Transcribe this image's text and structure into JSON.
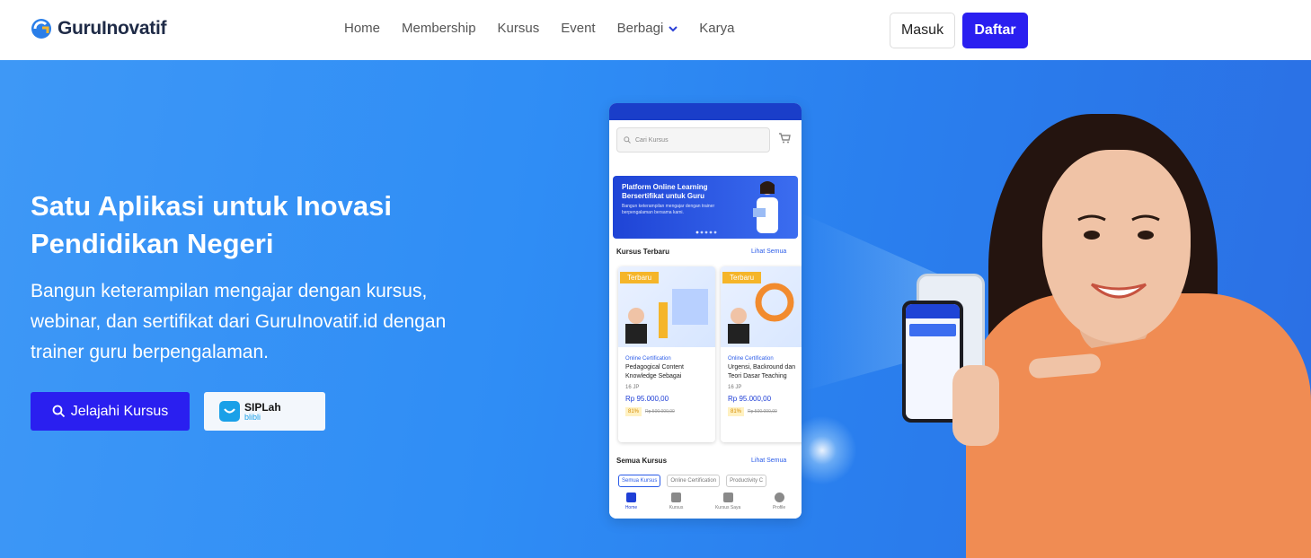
{
  "nav": {
    "logo_text": "GuruInovatif",
    "menu": [
      {
        "label": "Home"
      },
      {
        "label": "Membership"
      },
      {
        "label": "Kursus"
      },
      {
        "label": "Event"
      },
      {
        "label": "Berbagi",
        "has_dropdown": true
      },
      {
        "label": "Karya"
      }
    ],
    "login_label": "Masuk",
    "register_label": "Daftar"
  },
  "hero": {
    "title": "Satu Aplikasi untuk Inovasi Pendidikan Negeri",
    "subtitle": "Bangun keterampilan mengajar dengan kursus, webinar, dan sertifikat dari GuruInovatif.id dengan trainer guru berpengalaman.",
    "cta_label": "Jelajahi Kursus",
    "siplah_title": "SIPLah",
    "siplah_sub": "blibli"
  },
  "phone": {
    "search_placeholder": "Cari Kursus",
    "banner_title": "Platform Online Learning Bersertifikat untuk Guru",
    "banner_desc": "Bangun keterampilan mengajar dengan trainer berpengalaman bersama kami.",
    "section_latest": "Kursus Terbaru",
    "see_all": "Lihat Semua",
    "section_all": "Semua Kursus",
    "cards": [
      {
        "tag": "Terbaru",
        "category": "Online Certification",
        "name": "Pedagogical Content Knowledge Sebagai",
        "jp": "16 JP",
        "price": "Rp 95.000,00",
        "discount": "81%",
        "old_price": "Rp 500.000,00"
      },
      {
        "tag": "Terbaru",
        "category": "Online Certification",
        "name": "Urgensi, Backround dan Teori Dasar Teaching",
        "jp": "16 JP",
        "price": "Rp 95.000,00",
        "discount": "81%",
        "old_price": "Rp 500.000,00"
      }
    ],
    "chips": [
      "Semua Kursus",
      "Online Certification",
      "Productivity C"
    ],
    "bottom_nav": [
      "Home",
      "Kursus",
      "Kursus Saya",
      "Profile"
    ]
  },
  "colors": {
    "primary": "#2a1ff0",
    "hero_blue": "#2f8df5",
    "accent": "#f5b529"
  }
}
